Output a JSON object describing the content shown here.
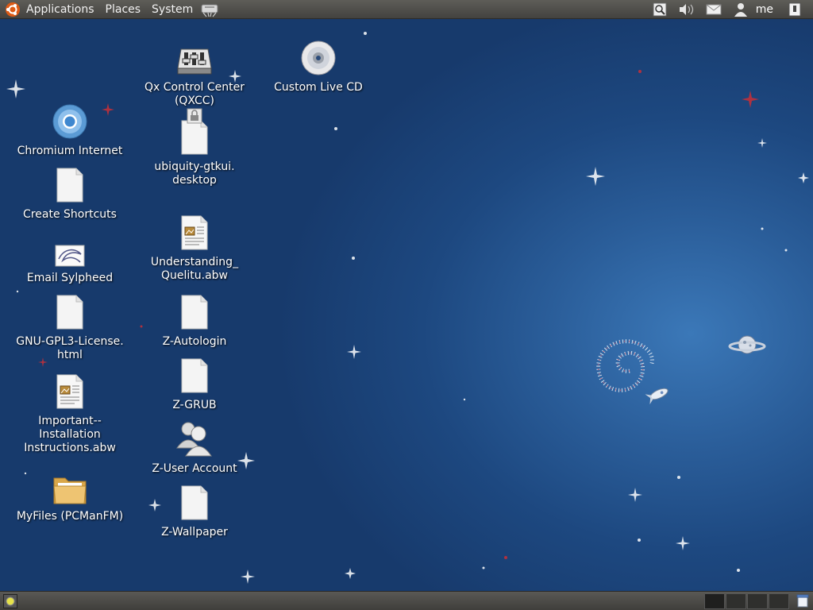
{
  "top_panel": {
    "menus": [
      "Applications",
      "Places",
      "System"
    ],
    "user": "me",
    "tray_icons": [
      "search-icon",
      "volume-icon",
      "mail-icon",
      "user-icon",
      "shutdown-icon"
    ]
  },
  "desktop": {
    "col1": [
      {
        "label": "Chromium Internet",
        "icon": "chromium-icon"
      },
      {
        "label": "Create Shortcuts",
        "icon": "document-icon"
      },
      {
        "label": "Email  Sylpheed",
        "icon": "email-icon"
      },
      {
        "label": "GNU-GPL3-License.\nhtml",
        "icon": "document-icon"
      },
      {
        "label": "Important--\nInstallation\nInstructions.abw",
        "icon": "abw-document-icon"
      },
      {
        "label": "MyFiles  (PCManFM)",
        "icon": "folder-icon"
      }
    ],
    "col2": [
      {
        "label": "Qx Control Center\n(QXCC)",
        "icon": "control-center-icon"
      },
      {
        "label": "ubiquity-gtkui.\ndesktop",
        "icon": "locked-document-icon"
      },
      {
        "label": "Understanding_\nQuelitu.abw",
        "icon": "abw-document-icon"
      },
      {
        "label": "Z-Autologin",
        "icon": "document-icon"
      },
      {
        "label": "Z-GRUB",
        "icon": "document-icon"
      },
      {
        "label": "Z-User Account",
        "icon": "users-icon"
      },
      {
        "label": "Z-Wallpaper",
        "icon": "document-icon"
      }
    ],
    "col3": [
      {
        "label": "Custom Live CD",
        "icon": "cd-icon"
      }
    ]
  },
  "bottom_panel": {
    "workspaces": 4,
    "active_workspace": 1
  }
}
